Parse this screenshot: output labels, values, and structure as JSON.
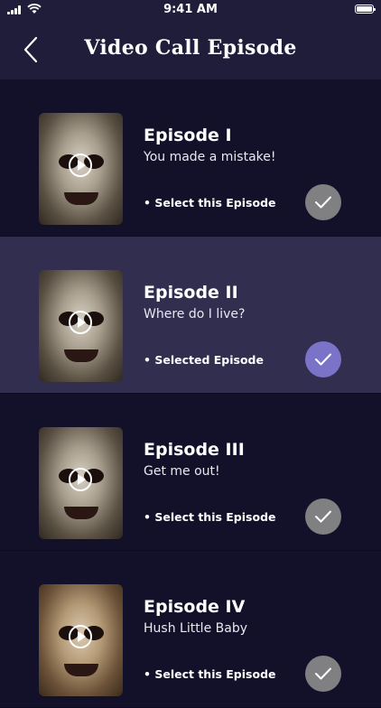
{
  "status_bar": {
    "time": "9:41 AM"
  },
  "nav": {
    "title": "Video Call Episode",
    "back_icon": "chevron-left-icon"
  },
  "episodes": [
    {
      "title": "Episode I",
      "subtitle": "You made a mistake!",
      "status": "• Select this Episode",
      "selected": false
    },
    {
      "title": "Episode II",
      "subtitle": "Where do I live?",
      "status": "• Selected Episode",
      "selected": true
    },
    {
      "title": "Episode III",
      "subtitle": "Get me out!",
      "status": "• Select this Episode",
      "selected": false
    },
    {
      "title": "Episode IV",
      "subtitle": "Hush Little Baby",
      "status": "• Select this Episode",
      "selected": false
    }
  ],
  "colors": {
    "background": "#13102a",
    "header": "#201d3a",
    "selected_row": "#312e4f",
    "check_active": "#7b73c8",
    "check_inactive": "#808083"
  }
}
